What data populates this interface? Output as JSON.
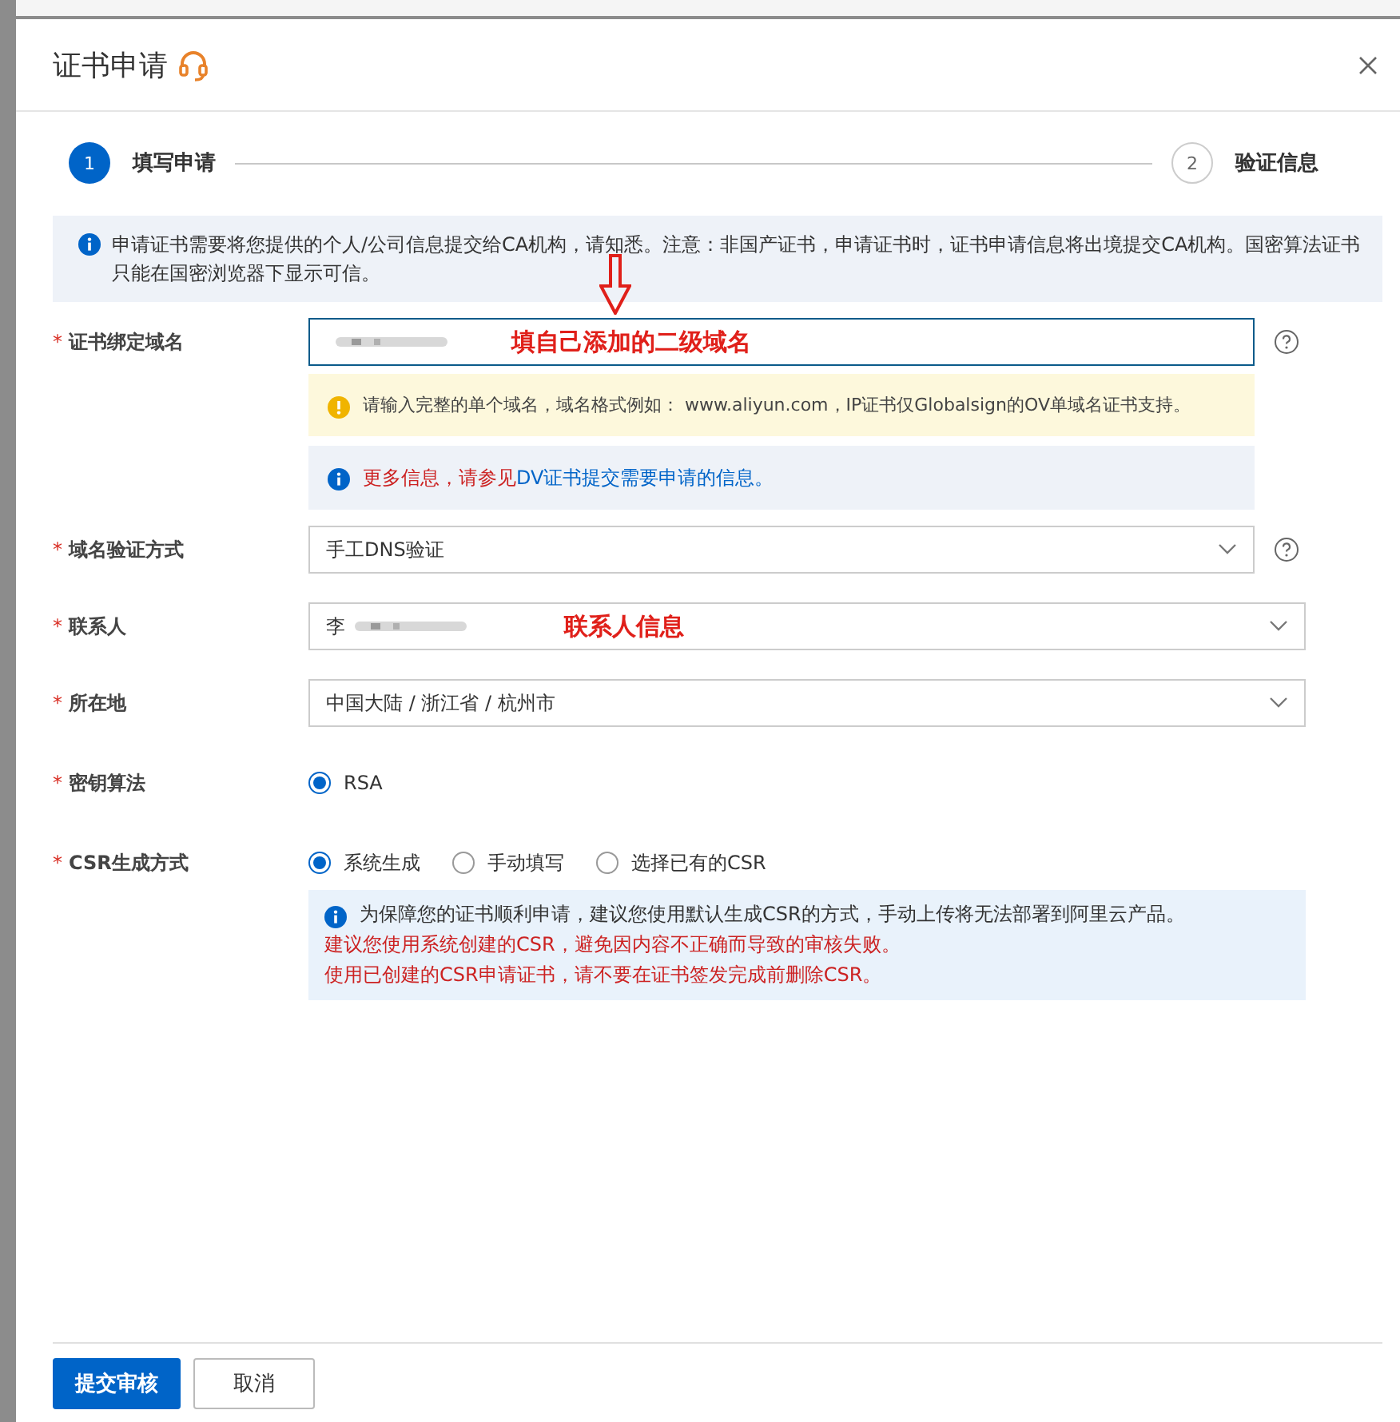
{
  "dialog": {
    "title": "证书申请"
  },
  "steps": [
    {
      "number": "1",
      "label": "填写申请",
      "selected": true
    },
    {
      "number": "2",
      "label": "验证信息",
      "selected": false
    }
  ],
  "notice": "申请证书需要将您提供的个人/公司信息提交给CA机构，请知悉。注意：非国产证书，申请证书时，证书申请信息将出境提交CA机构。国密算法证书只能在国密浏览器下显示可信。",
  "fields": [
    {
      "kind": "input",
      "label": "证书绑定域名",
      "required_mark": "*",
      "redacted": true,
      "help": true,
      "pointer_arrow": true,
      "annotation": "填自己添加的二级域名",
      "hints": [
        {
          "kind": "warning",
          "text": "请输入完整的单个域名，域名格式例如： www.aliyun.com，IP证书仅Globalsign的OV单域名证书支持。"
        },
        {
          "kind": "info",
          "text": "更多信息，请参见",
          "link": "DV证书提交需要申请的信息。"
        }
      ]
    },
    {
      "kind": "select",
      "label": "域名验证方式",
      "required_mark": "*",
      "value": "手工DNS验证",
      "help": true
    },
    {
      "kind": "select",
      "label": "联系人",
      "required_mark": "*",
      "value": "李",
      "redacted": true,
      "annotation": "联系人信息"
    },
    {
      "kind": "select",
      "label": "所在地",
      "required_mark": "*",
      "value": "中国大陆 / 浙江省 / 杭州市"
    },
    {
      "kind": "radio",
      "label": "密钥算法",
      "required_mark": "*",
      "options": [
        {
          "label": "RSA",
          "selected": true
        }
      ]
    },
    {
      "kind": "radio",
      "label": "CSR生成方式",
      "required_mark": "*",
      "options": [
        {
          "label": "系统生成",
          "selected": true
        },
        {
          "label": "手动填写",
          "selected": false
        },
        {
          "label": "选择已有的CSR",
          "selected": false
        }
      ],
      "note": {
        "text": "为保障您的证书顺利申请，建议您使用默认生成CSR的方式，手动上传将无法部署到阿里云产品。",
        "warnings": [
          "建议您使用系统创建的CSR，避免因内容不正确而导致的审核失败。",
          "使用已创建的CSR申请证书，请不要在证书签发完成前删除CSR。"
        ]
      }
    }
  ],
  "buttons": [
    {
      "label": "提交审核",
      "kind": "primary"
    },
    {
      "label": "取消",
      "kind": "default"
    }
  ]
}
